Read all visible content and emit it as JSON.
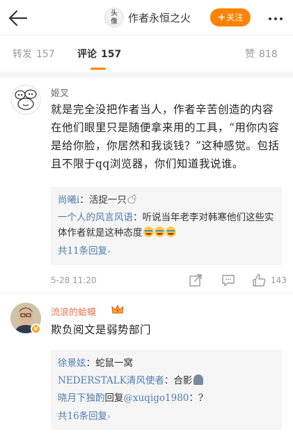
{
  "header": {
    "avatar_text_1": "头",
    "avatar_text_2": "像",
    "author_name": "作者永恒之火",
    "follow_label": "关注",
    "follow_plus": "+",
    "accent_color": "#ff8200"
  },
  "tabs": {
    "repost_label": "转发",
    "repost_count": "157",
    "comment_label": "评论",
    "comment_count": "157",
    "like_label": "赞",
    "like_count": "818"
  },
  "comments": [
    {
      "username": "姬叉",
      "text": "就是完全没把作者当人，作者辛苦创造的内容在他们眼里只是随便拿来用的工具，“用你内容是给你脸，你居然和我谈钱？”这种感觉。包括且不限于qq浏览器，你们知道我说谁。",
      "replies": [
        {
          "name": "尚曦i",
          "sep": "：",
          "text": "活捉一只",
          "icon": "chicken-icon"
        },
        {
          "name": "一个人的风言风语",
          "sep": "：",
          "text": "听说当年老李对韩寒他们这些实体作者就是这种态度",
          "icon": "crying-emoji-icon"
        }
      ],
      "more_replies": "共11条回复",
      "more_arrow": "›",
      "timestamp": "5-28 11:20",
      "like_count": "143"
    },
    {
      "username": "流浪的蛤蟆",
      "text": "欺负阅文是弱势部门",
      "verified_mark": "V",
      "replies": [
        {
          "name": "徐景妶",
          "sep": "：",
          "text": "蛇鼠一窝"
        },
        {
          "name": "NEDERSTALK清风使者",
          "sep": "：",
          "text": "合影",
          "icon": "ghost-emoji-icon"
        },
        {
          "name": "晓月下独酌",
          "reply_word": "回复",
          "mention": "@xuqigo1980",
          "sep": "：",
          "text": "?"
        }
      ],
      "more_replies": "共16条回复",
      "more_arrow": "›"
    }
  ]
}
